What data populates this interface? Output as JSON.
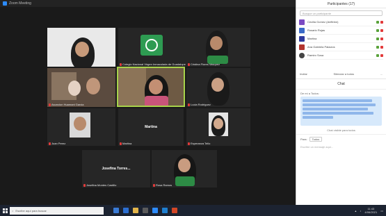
{
  "window": {
    "title": "Zoom Meeting"
  },
  "tiles": [
    {
      "name": ""
    },
    {
      "name": "Colegio Nacional Virgen Inmaculada de Guadalupe"
    },
    {
      "name": "Cristina Flores Vasquez"
    },
    {
      "name": "Asuncion Huamani Garcia"
    },
    {
      "name": ""
    },
    {
      "name": "Lucia Rodriguez"
    },
    {
      "name": "Juan Perez"
    },
    {
      "name": "Martina",
      "label": "Martina"
    },
    {
      "name": "Esperanza Tello"
    },
    {
      "name": "Josefina Montes Castillo",
      "label": "Josefina Torres..."
    },
    {
      "name": "Rosa Ramos"
    }
  ],
  "participants": {
    "header": "Participantes (17)",
    "search_placeholder": "Busque un participante",
    "list": [
      {
        "name": "Cecilia Gomez (Anfitrión)",
        "color": "#7b4ac2"
      },
      {
        "name": "Rosario Rojas",
        "color": "#3b6bc8"
      },
      {
        "name": "Martina",
        "color": "#2f3a9e"
      },
      {
        "name": "Ana Gabriela Palacios",
        "color": "#b2342e"
      },
      {
        "name": "Ramiro Sosa",
        "color": "#444444"
      }
    ],
    "invite": "Invitar",
    "mute_all": "Silenciar a todos",
    "more": "..."
  },
  "chat": {
    "header": "Chat",
    "from": "De mí a Todos:",
    "footer": "Chat visible para todos",
    "to_label": "Para:",
    "to_value": "Todos",
    "input_placeholder": "Escribe un mensaje aquí..."
  },
  "taskbar": {
    "search": "Escribe aquí para buscar",
    "time": "11:43",
    "date": "4/06/2021"
  }
}
